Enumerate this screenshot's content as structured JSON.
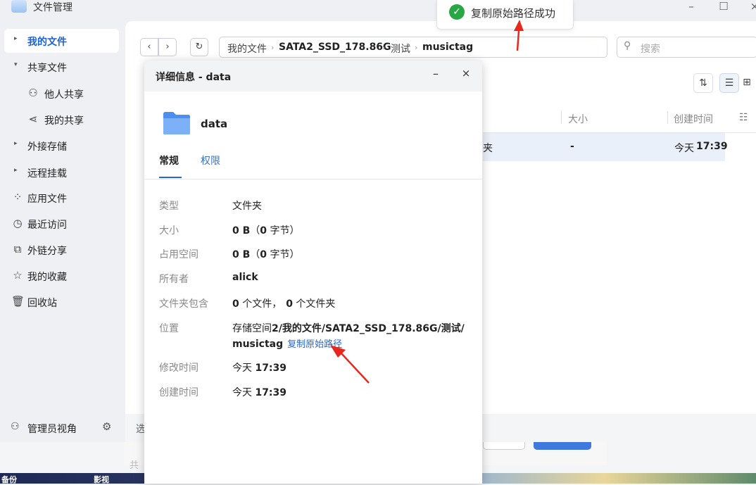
{
  "window": {
    "title": "文件管理",
    "minimize": "–",
    "maximize": "☐",
    "close": "×"
  },
  "sidebar": {
    "items": [
      {
        "label": "我的文件"
      },
      {
        "label": "共享文件"
      },
      {
        "label": "他人共享"
      },
      {
        "label": "我的共享"
      },
      {
        "label": "外接存储"
      },
      {
        "label": "远程挂载"
      },
      {
        "label": "应用文件"
      },
      {
        "label": "最近访问"
      },
      {
        "label": "外链分享"
      },
      {
        "label": "我的收藏"
      },
      {
        "label": "回收站"
      }
    ],
    "footer_label": "管理员视角"
  },
  "toolbar": {
    "back": "‹",
    "forward": "›",
    "refresh": "↻",
    "breadcrumb": [
      "我的文件",
      "SATA2_SSD_178.86G",
      "测试",
      "musictag"
    ],
    "search_placeholder": "搜索"
  },
  "file_list": {
    "columns": [
      "大小",
      "创建时间"
    ],
    "row": {
      "name_fragment": "夹",
      "size": "-",
      "created_prefix": "今天",
      "created_time": "17:39"
    }
  },
  "bottom_bar": {
    "text_fragment": "选",
    "under_fragment": "共"
  },
  "desktop": {
    "labels": [
      "备份",
      "影视"
    ]
  },
  "toast": {
    "message": "复制原始路径成功"
  },
  "dialog": {
    "title": "详细信息 - data",
    "minimize": "–",
    "close": "×",
    "folder_name": "data",
    "tabs": [
      "常规",
      "权限"
    ],
    "fields": {
      "type_label": "类型",
      "type_value": "文件夹",
      "size_label": "大小",
      "size_num": "0 B",
      "size_paren_open": "（",
      "size_bytes": "0",
      "size_unit": " 字节）",
      "used_label": "占用空间",
      "used_num": "0 B",
      "used_paren_open": "（",
      "used_bytes": "0",
      "used_unit": " 字节）",
      "owner_label": "所有者",
      "owner_value": "alick",
      "contains_label": "文件夹包含",
      "contains_files": "0",
      "contains_files_unit": " 个文件，",
      "contains_folders": "0",
      "contains_folders_unit": " 个文件夹",
      "location_label": "位置",
      "location_prefix": "存储空间",
      "location_path": "2/我的文件/SATA2_SSD_178.86G/测试/musictag",
      "copy_link": "复制原始路径",
      "modified_label": "修改时间",
      "modified_prefix": "今天 ",
      "modified_time": "17:39",
      "created_label": "创建时间",
      "created_prefix": "今天 ",
      "created_time": "17:39"
    }
  },
  "colors": {
    "accent": "#2a66d3",
    "success": "#29a745",
    "annotation_arrow": "#e8281e"
  }
}
